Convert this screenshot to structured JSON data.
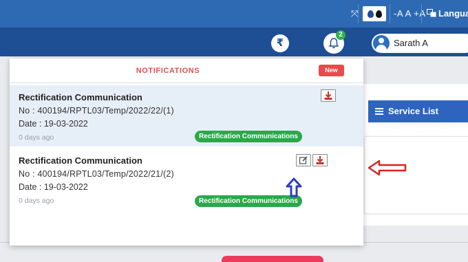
{
  "topbar": {
    "move_glyph": "⤧",
    "font_controls": "-A A +A",
    "language_label": "Language"
  },
  "header": {
    "rupee_glyph": "₹",
    "notification_count": "2",
    "user_name": "Sarath A"
  },
  "background": {
    "service_list_label": "Service List"
  },
  "notifications": {
    "heading": "NOTIFICATIONS",
    "new_label": "New",
    "items": [
      {
        "title": "Rectification Communication",
        "number": "No : 400194/RPTL03/Temp/2022/22/(1)",
        "date": "Date : 19-03-2022",
        "age": "0 days ago",
        "tag": "Rectification Communications"
      },
      {
        "title": "Rectification Communication",
        "number": "No : 400194/RPTL03/Temp/2022/21/(2)",
        "date": "Date : 19-03-2022",
        "age": "0 days ago",
        "tag": "Rectification Communications"
      }
    ]
  },
  "colors": {
    "topbar": "#2e6ab3",
    "header": "#1e4f95",
    "tag_green": "#2aa84a",
    "new_red": "#e84b4b",
    "annotation_red": "#e02020",
    "annotation_blue": "#2a3fbf"
  },
  "icons": [
    "move-icon",
    "contrast-icon",
    "language-icon",
    "rupee-icon",
    "bell-icon",
    "user-avatar-icon",
    "download-icon",
    "edit-icon",
    "list-icon"
  ]
}
